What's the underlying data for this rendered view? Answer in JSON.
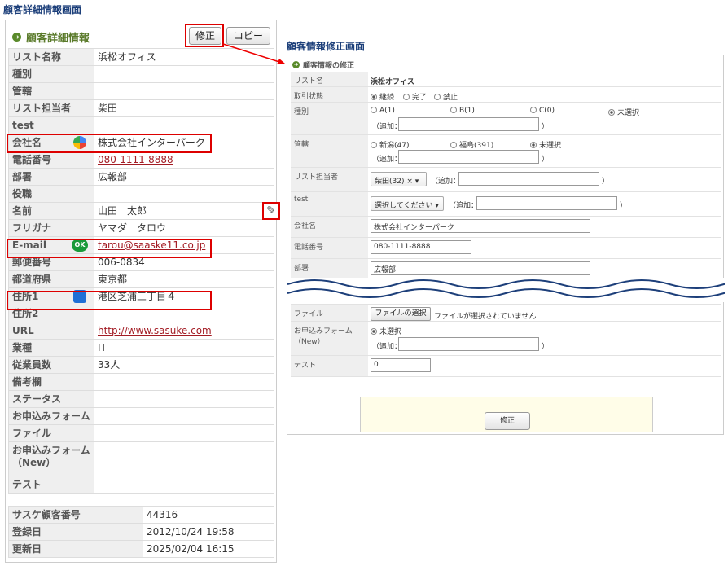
{
  "captions": {
    "left": "顧客詳細情報画面",
    "right": "顧客情報修正画面"
  },
  "detail": {
    "title": "顧客詳細情報",
    "edit_button": "修正",
    "copy_button": "コピー",
    "rows": [
      {
        "label": "リスト名称",
        "value": "浜松オフィス"
      },
      {
        "label": "種別",
        "value": ""
      },
      {
        "label": "管轄",
        "value": ""
      },
      {
        "label": "リスト担当者",
        "value": "柴田"
      },
      {
        "label": "test",
        "value": ""
      },
      {
        "label": "会社名",
        "value": "株式会社インターパーク"
      },
      {
        "label": "電話番号",
        "value": "080-1111-8888"
      },
      {
        "label": "部署",
        "value": "広報部"
      },
      {
        "label": "役職",
        "value": ""
      },
      {
        "label": "名前",
        "value": "山田　太郎"
      },
      {
        "label": "フリガナ",
        "value": "ヤマダ　タロウ"
      },
      {
        "label": "E-mail",
        "value": "tarou@saaske11.co.jp"
      },
      {
        "label": "郵便番号",
        "value": "006-0834"
      },
      {
        "label": "都道府県",
        "value": "東京都"
      },
      {
        "label": "住所1",
        "value": "港区芝浦三丁目４"
      },
      {
        "label": "住所2",
        "value": ""
      },
      {
        "label": "URL",
        "value": "http://www.sasuke.com"
      },
      {
        "label": "業種",
        "value": "IT"
      },
      {
        "label": "従業員数",
        "value": "33人"
      },
      {
        "label": "備考欄",
        "value": ""
      },
      {
        "label": "ステータス",
        "value": ""
      },
      {
        "label": "お申込みフォーム",
        "value": ""
      },
      {
        "label": "ファイル",
        "value": ""
      },
      {
        "label": "お申込みフォーム（New）",
        "value": ""
      },
      {
        "label": "テスト",
        "value": ""
      }
    ],
    "meta": [
      {
        "label": "サスケ顧客番号",
        "value": "44316"
      },
      {
        "label": "登録日",
        "value": "2012/10/24 19:58"
      },
      {
        "label": "更新日",
        "value": "2025/02/04 16:15"
      }
    ],
    "email_badge": "OK"
  },
  "edit": {
    "title": "顧客情報の修正",
    "list_name_label": "リスト名",
    "list_name_value": "浜松オフィス",
    "deal_label": "取引状態",
    "deal_opts": [
      "継続",
      "完了",
      "禁止"
    ],
    "type_label": "種別",
    "type_opts": [
      "A(1)",
      "B(1)",
      "C(0)",
      "未選択"
    ],
    "add_label": "（追加：",
    "close_paren": "）",
    "jur_label": "管轄",
    "jur_opts": [
      "新潟(47)",
      "福島(391)",
      "未選択"
    ],
    "owner_label": "リスト担当者",
    "owner_value": "柴田(32)",
    "owner_x": "×",
    "test_label": "test",
    "test_placeholder": "選択してください",
    "company_label": "会社名",
    "company_value": "株式会社インターパーク",
    "phone_label": "電話番号",
    "phone_value": "080-1111-8888",
    "dept_label": "部署",
    "dept_value": "広報部",
    "file_label": "ファイル",
    "file_button": "ファイルの選択",
    "file_status": "ファイルが選択されていません",
    "form_label": "お申込みフォーム（New）",
    "form_opt": "未選択",
    "test2_label": "テスト",
    "test2_value": "0",
    "submit": "修正"
  }
}
